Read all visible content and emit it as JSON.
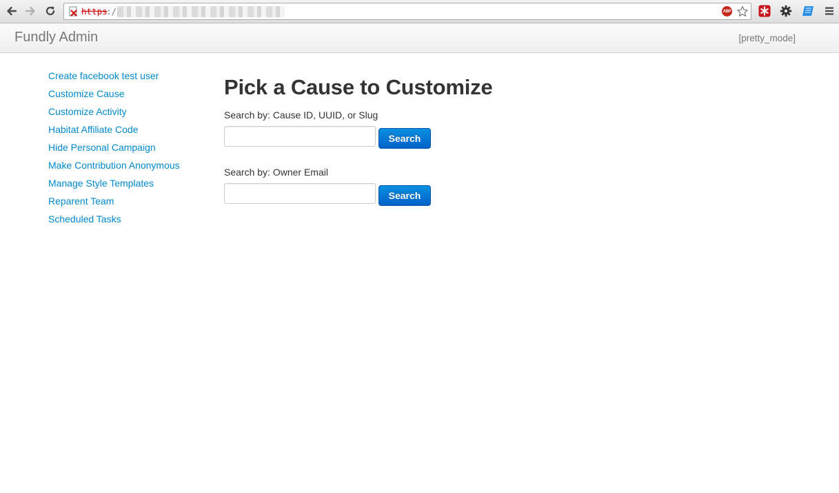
{
  "browser": {
    "url_scheme": "https",
    "url_separator": "://",
    "adblock_label": "ABP"
  },
  "appbar": {
    "brand": "Fundly Admin",
    "mode_link": "[pretty_mode]"
  },
  "sidebar": {
    "items": [
      {
        "label": "Create facebook test user"
      },
      {
        "label": "Customize Cause"
      },
      {
        "label": "Customize Activity"
      },
      {
        "label": "Habitat Affiliate Code"
      },
      {
        "label": "Hide Personal Campaign"
      },
      {
        "label": "Make Contribution Anonymous"
      },
      {
        "label": "Manage Style Templates"
      },
      {
        "label": "Reparent Team"
      },
      {
        "label": "Scheduled Tasks"
      }
    ]
  },
  "main": {
    "title": "Pick a Cause to Customize",
    "forms": [
      {
        "label": "Search by: Cause ID, UUID, or Slug",
        "value": "",
        "button": "Search"
      },
      {
        "label": "Search by: Owner Email",
        "value": "",
        "button": "Search"
      }
    ]
  },
  "colors": {
    "link": "#0088cc",
    "button_primary": "#0074d9",
    "text": "#333333",
    "brand": "#777777"
  }
}
